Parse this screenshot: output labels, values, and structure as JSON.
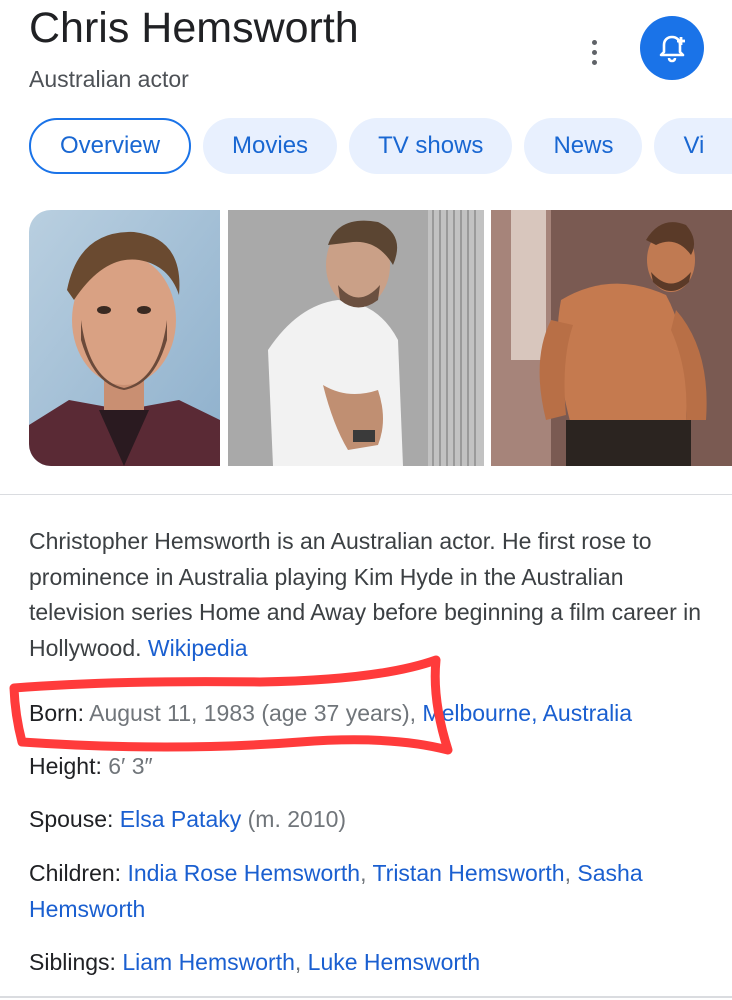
{
  "header": {
    "title": "Chris Hemsworth",
    "subtitle": "Australian actor",
    "menu_icon": "more-vert-icon",
    "follow_icon": "bell-plus-icon"
  },
  "tabs": [
    "Overview",
    "Movies",
    "TV shows",
    "News",
    "Vi"
  ],
  "images": [
    "headshot photo",
    "white t-shirt photo",
    "shirtless photo"
  ],
  "description": {
    "text": "Christopher Hemsworth is an Australian actor. He first rose to prominence in Australia playing Kim Hyde in the Australian television series Home and Away before beginning a film career in Hollywood.",
    "source_link": "Wikipedia"
  },
  "facts": {
    "born": {
      "label": "Born:",
      "value": "August 11, 1983 (age 37 years),",
      "place": "Melbourne, Australia"
    },
    "height": {
      "label": "Height:",
      "value": "6′ 3″"
    },
    "spouse": {
      "label": "Spouse:",
      "name": "Elsa Pataky",
      "note": "(m. 2010)"
    },
    "children": {
      "label": "Children:",
      "items": [
        "India Rose Hemsworth",
        "Tristan Hemsworth",
        "Sasha Hemsworth"
      ]
    },
    "siblings": {
      "label": "Siblings:",
      "items": [
        "Liam Hemsworth",
        "Luke Hemsworth"
      ]
    }
  },
  "colors": {
    "accent": "#1a73e8",
    "link": "#1a5fd0",
    "tab_bg": "#e8f0fe",
    "annotation": "#ff3b3b"
  }
}
